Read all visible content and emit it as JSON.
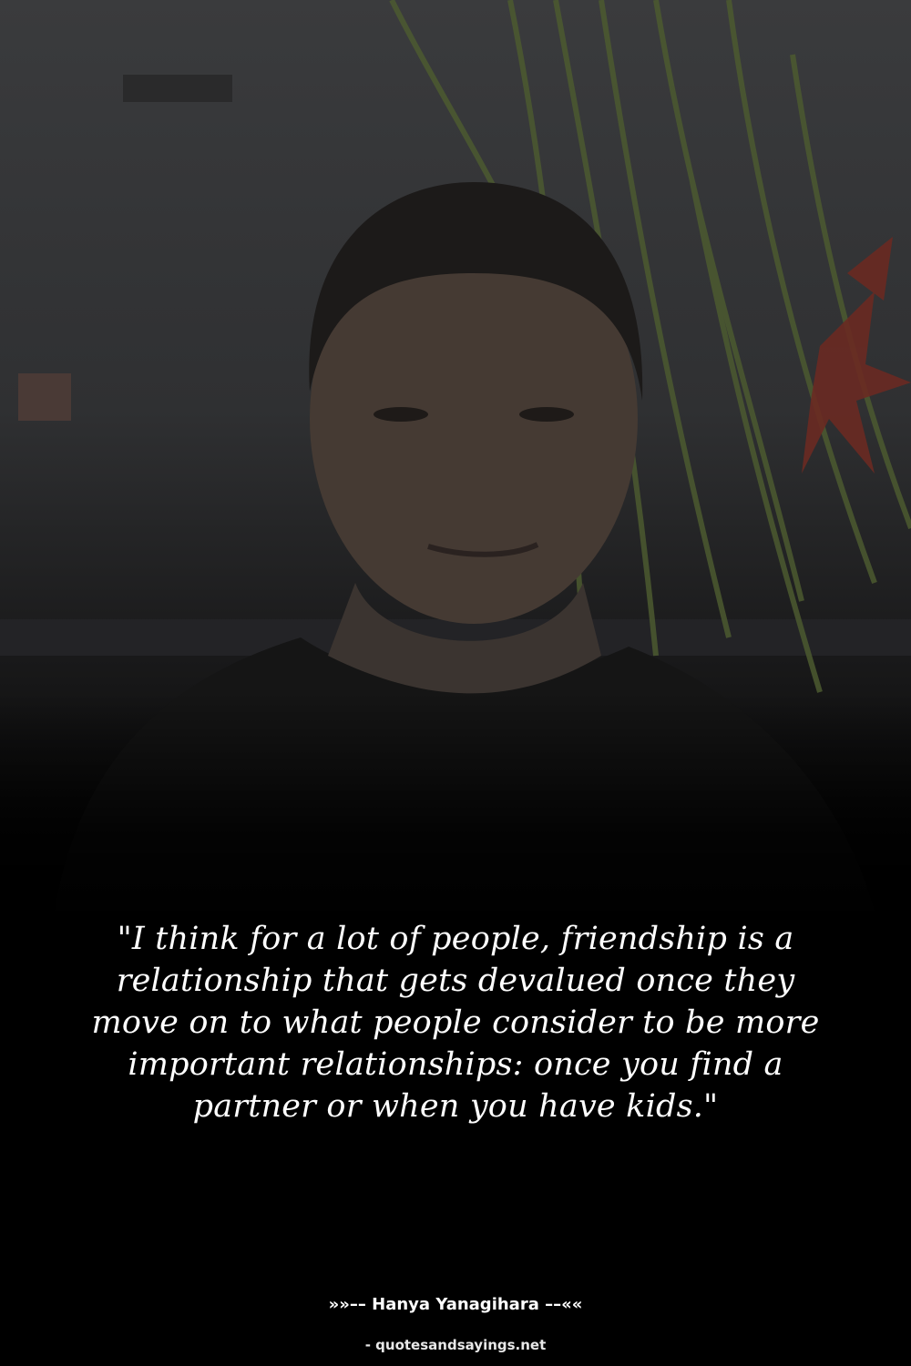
{
  "quote": {
    "text": "\"I think for a lot of people, friendship is a relationship that gets devalued once they move on to what people consider to be more important relationships: once you find a partner or when you have kids.\""
  },
  "author": {
    "line": "»»–– Hanya Yanagihara ––««"
  },
  "site": {
    "credit": "- quotesandsayings.net"
  },
  "colors": {
    "background": "#000000",
    "text": "#ffffff"
  }
}
